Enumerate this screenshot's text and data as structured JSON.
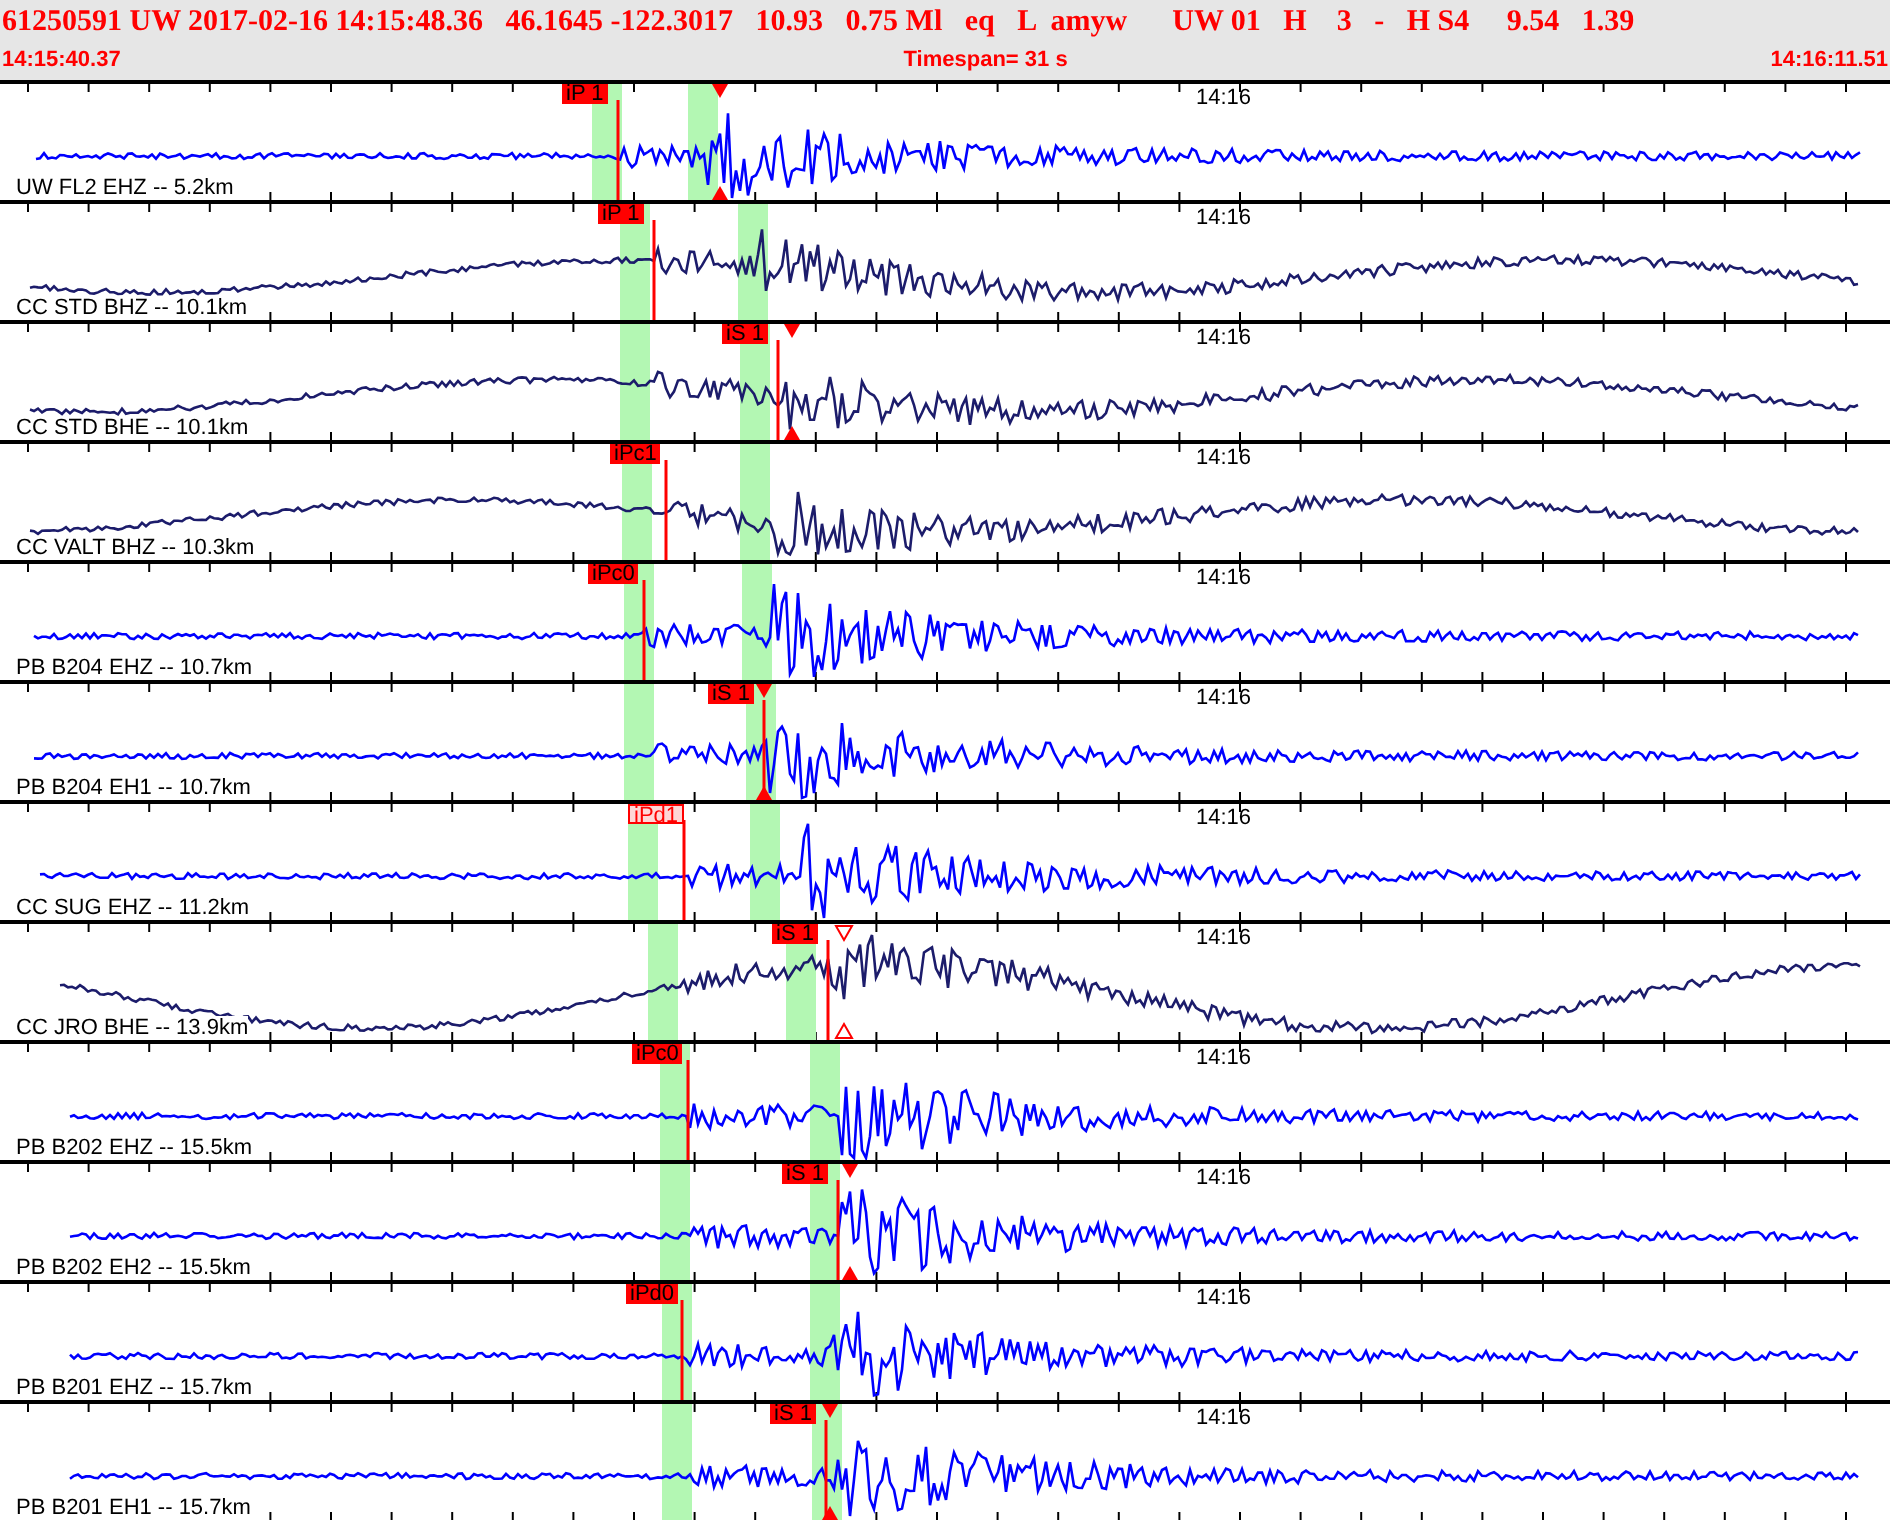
{
  "header": {
    "summary": "61250591 UW 2017-02-16 14:15:48.36   46.1645 -122.3017   10.93   0.75 Ml   eq   L  amyw      UW 01   H    3   -   H S4     9.54   1.39",
    "start_time": "14:15:40.37",
    "timespan": "Timespan=  31 s",
    "end_time": "14:16:11.51"
  },
  "traces": [
    {
      "label": "UW FL2 EHZ -- 5.2km",
      "time_label": "14:16",
      "color": "#0000ff",
      "pick": {
        "label": "iP 1",
        "kind": "normal"
      },
      "kind": "filled"
    },
    {
      "label": "CC STD BHZ -- 10.1km",
      "time_label": "14:16",
      "color": "#1c1c6b",
      "pick": {
        "label": "iP 1",
        "kind": "normal"
      }
    },
    {
      "label": "CC STD BHE -- 10.1km",
      "time_label": "14:16",
      "color": "#1c1c6b",
      "pick": {
        "label": "iS 1",
        "kind": "normal"
      },
      "kind": "filled"
    },
    {
      "label": "CC VALT BHZ -- 10.3km",
      "time_label": "14:16",
      "color": "#1c1c6b",
      "pick": {
        "label": "iPc1",
        "kind": "normal"
      }
    },
    {
      "label": "PB B204 EHZ -- 10.7km",
      "time_label": "14:16",
      "color": "#0000ff",
      "pick": {
        "label": "iPc0",
        "kind": "normal"
      }
    },
    {
      "label": "PB B204 EH1 -- 10.7km",
      "time_label": "14:16",
      "color": "#0000ff",
      "pick": {
        "label": "iS 1",
        "kind": "normal"
      },
      "kind": "filled"
    },
    {
      "label": "CC SUG EHZ -- 11.2km",
      "time_label": "14:16",
      "color": "#0000ff",
      "pick": {
        "label": "iPd1",
        "kind": "faded"
      }
    },
    {
      "label": "CC JRO BHE -- 13.9km",
      "time_label": "14:16",
      "color": "#1c1c6b",
      "pick": {
        "label": "iS 1",
        "kind": "normal"
      },
      "kind": "hollow"
    },
    {
      "label": "PB B202 EHZ -- 15.5km",
      "time_label": "14:16",
      "color": "#0000ff",
      "pick": {
        "label": "iPc0",
        "kind": "normal"
      }
    },
    {
      "label": "PB B202 EH2 -- 15.5km",
      "time_label": "14:16",
      "color": "#0000ff",
      "pick": {
        "label": "iS 1",
        "kind": "normal"
      },
      "kind": "filled"
    },
    {
      "label": "PB B201 EHZ -- 15.7km",
      "time_label": "14:16",
      "color": "#0000ff",
      "pick": {
        "label": "iPd0",
        "kind": "normal"
      }
    },
    {
      "label": "PB B201 EH1 -- 15.7km",
      "time_label": "14:16",
      "color": "#0000ff",
      "pick": {
        "label": "iS 1",
        "kind": "normal"
      },
      "kind": "filled"
    }
  ]
}
